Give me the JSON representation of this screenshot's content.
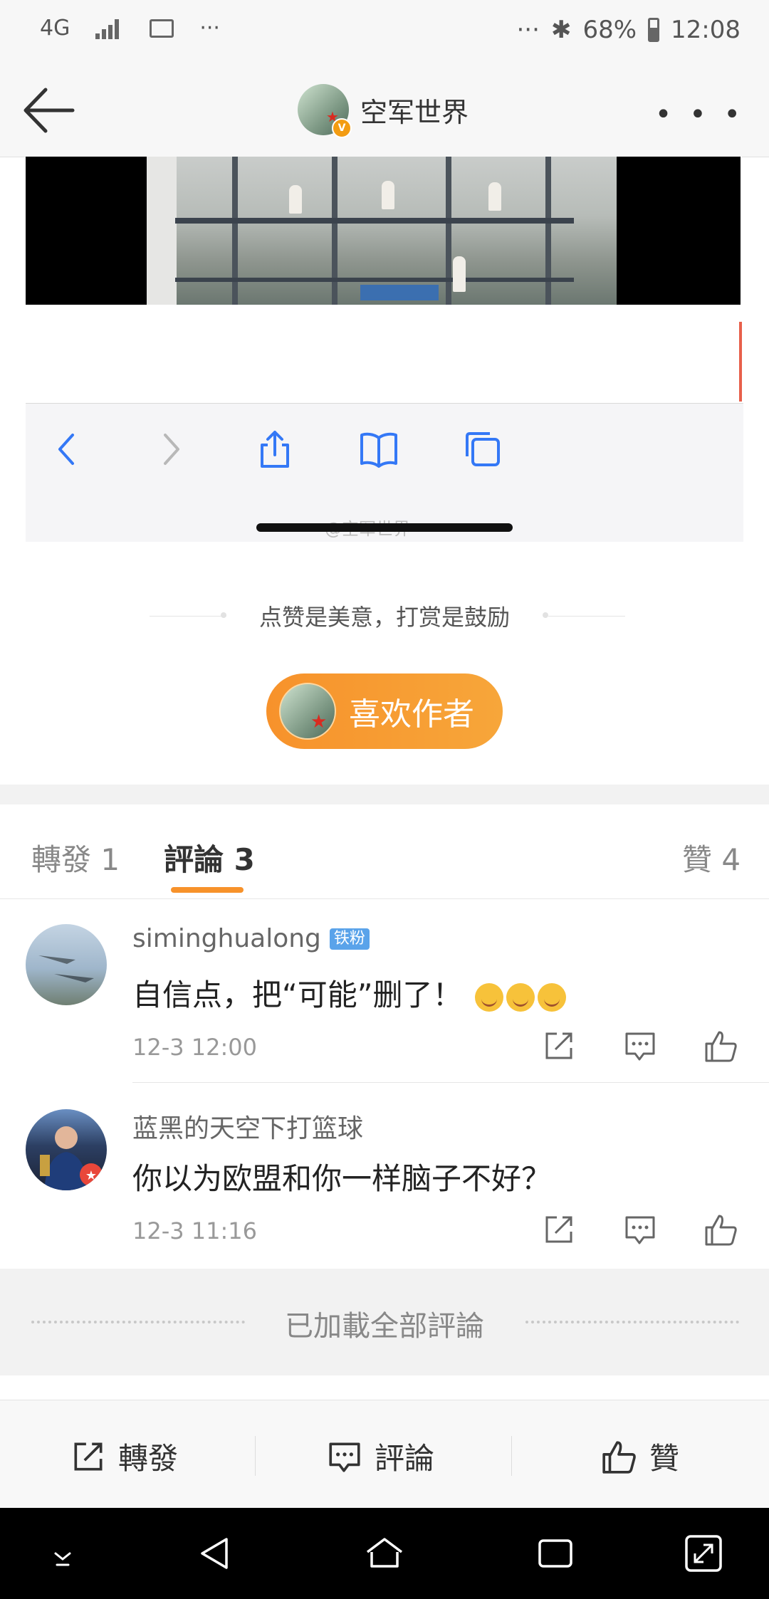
{
  "status_bar": {
    "network": "4G",
    "overflow": "···",
    "right_overflow": "···",
    "battery": "68%",
    "time": "12:08"
  },
  "header": {
    "title": "空军世界",
    "more": "• • •"
  },
  "embed": {
    "watermark": "@空军世界"
  },
  "reward": {
    "slogan": "点赞是美意，打赏是鼓励",
    "like_author_label": "喜欢作者"
  },
  "tabs": [
    {
      "label": "轉發 1"
    },
    {
      "label": "評論 3"
    },
    {
      "label": "贊 4"
    }
  ],
  "comments": [
    {
      "user": "siminghualong",
      "badge": "铁粉",
      "text": "自信点，把“可能”删了！",
      "time": "12-3 12:00"
    },
    {
      "user": "蓝黑的天空下打篮球",
      "text": "你以为欧盟和你一样脑子不好？",
      "time": "12-3 11:16"
    }
  ],
  "loaded_all": "已加載全部評論",
  "action_bar": {
    "repost": "轉發",
    "comment": "評論",
    "like": "贊"
  },
  "colors": {
    "accent": "#f7922b",
    "fan_badge": "#5aa3ea"
  }
}
